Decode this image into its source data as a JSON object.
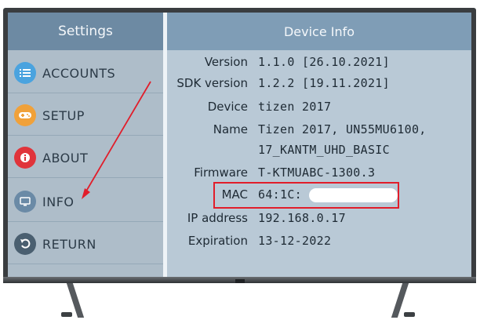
{
  "sidebar": {
    "title": "Settings",
    "items": [
      {
        "label": "ACCOUNTS",
        "icon": "list-icon",
        "color": "#4aa3df"
      },
      {
        "label": "SETUP",
        "icon": "gamepad-icon",
        "color": "#f0a13a"
      },
      {
        "label": "ABOUT",
        "icon": "info-icon",
        "color": "#e0343b"
      },
      {
        "label": "INFO",
        "icon": "tv-icon",
        "color": "#6a8aa6"
      },
      {
        "label": "RETURN",
        "icon": "return-icon",
        "color": "#4a5f70"
      }
    ]
  },
  "content": {
    "title": "Device Info",
    "rows": [
      {
        "label": "Version",
        "value": "1.1.0 [26.10.2021]"
      },
      {
        "label": "SDK version",
        "value": "1.2.2 [19.11.2021]"
      },
      {
        "label": "Device",
        "value": "tizen 2017"
      },
      {
        "label": "Name",
        "value": "Tizen 2017, UN55MU6100,",
        "value2": "17_KANTM_UHD_BASIC"
      },
      {
        "label": "Firmware",
        "value": "T-KTMUABC-1300.3"
      },
      {
        "label": "MAC",
        "value": "64:1C:"
      },
      {
        "label": "IP address",
        "value": "192.168.0.17"
      },
      {
        "label": "Expiration",
        "value": "13-12-2022"
      }
    ]
  },
  "annotations": {
    "highlight_color": "#e11d2a"
  }
}
